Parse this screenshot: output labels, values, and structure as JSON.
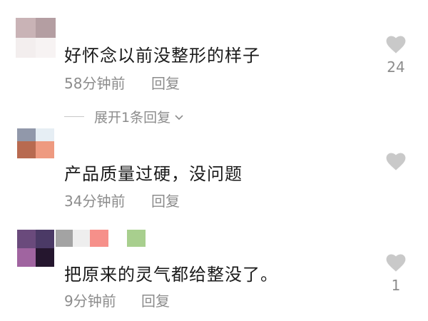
{
  "comments": [
    {
      "text": "好怀念以前没整形的样子",
      "time": "58分钟前",
      "reply": "回复",
      "likes": "24",
      "expand": "展开1条回复"
    },
    {
      "text": "产品质量过硬，没问题",
      "time": "34分钟前",
      "reply": "回复",
      "likes": ""
    },
    {
      "text": "把原来的灵气都给整没了。",
      "time": "9分钟前",
      "reply": "回复",
      "likes": "1"
    }
  ],
  "icons": {
    "like": "heart-icon",
    "expand": "chevron-down-icon"
  },
  "colors": {
    "text": "#1a1a1a",
    "meta": "#8c8c8c",
    "heart": "#c9c9c9"
  }
}
